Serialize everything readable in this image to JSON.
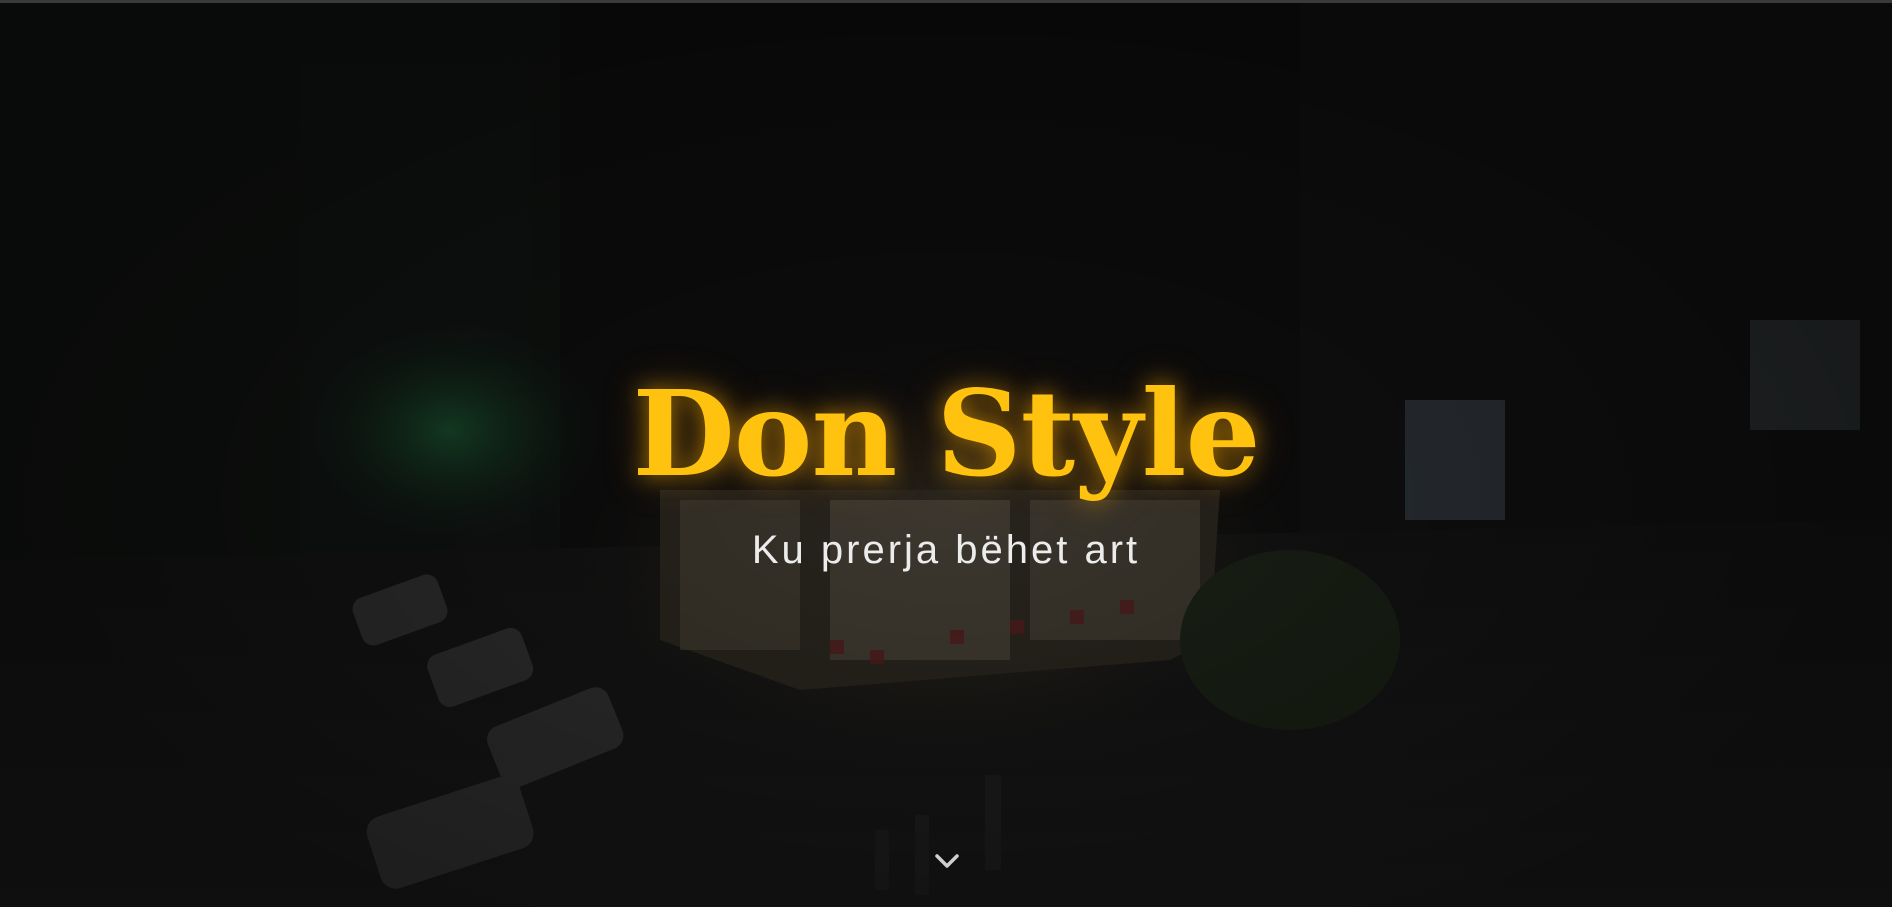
{
  "hero": {
    "title": "Don Style",
    "subtitle": "Ku prerja bëhet art",
    "scroll_icon": "chevron-down-icon"
  },
  "colors": {
    "title": "#ffc20e",
    "subtitle": "#ececec",
    "background": "#0e0e0e"
  }
}
